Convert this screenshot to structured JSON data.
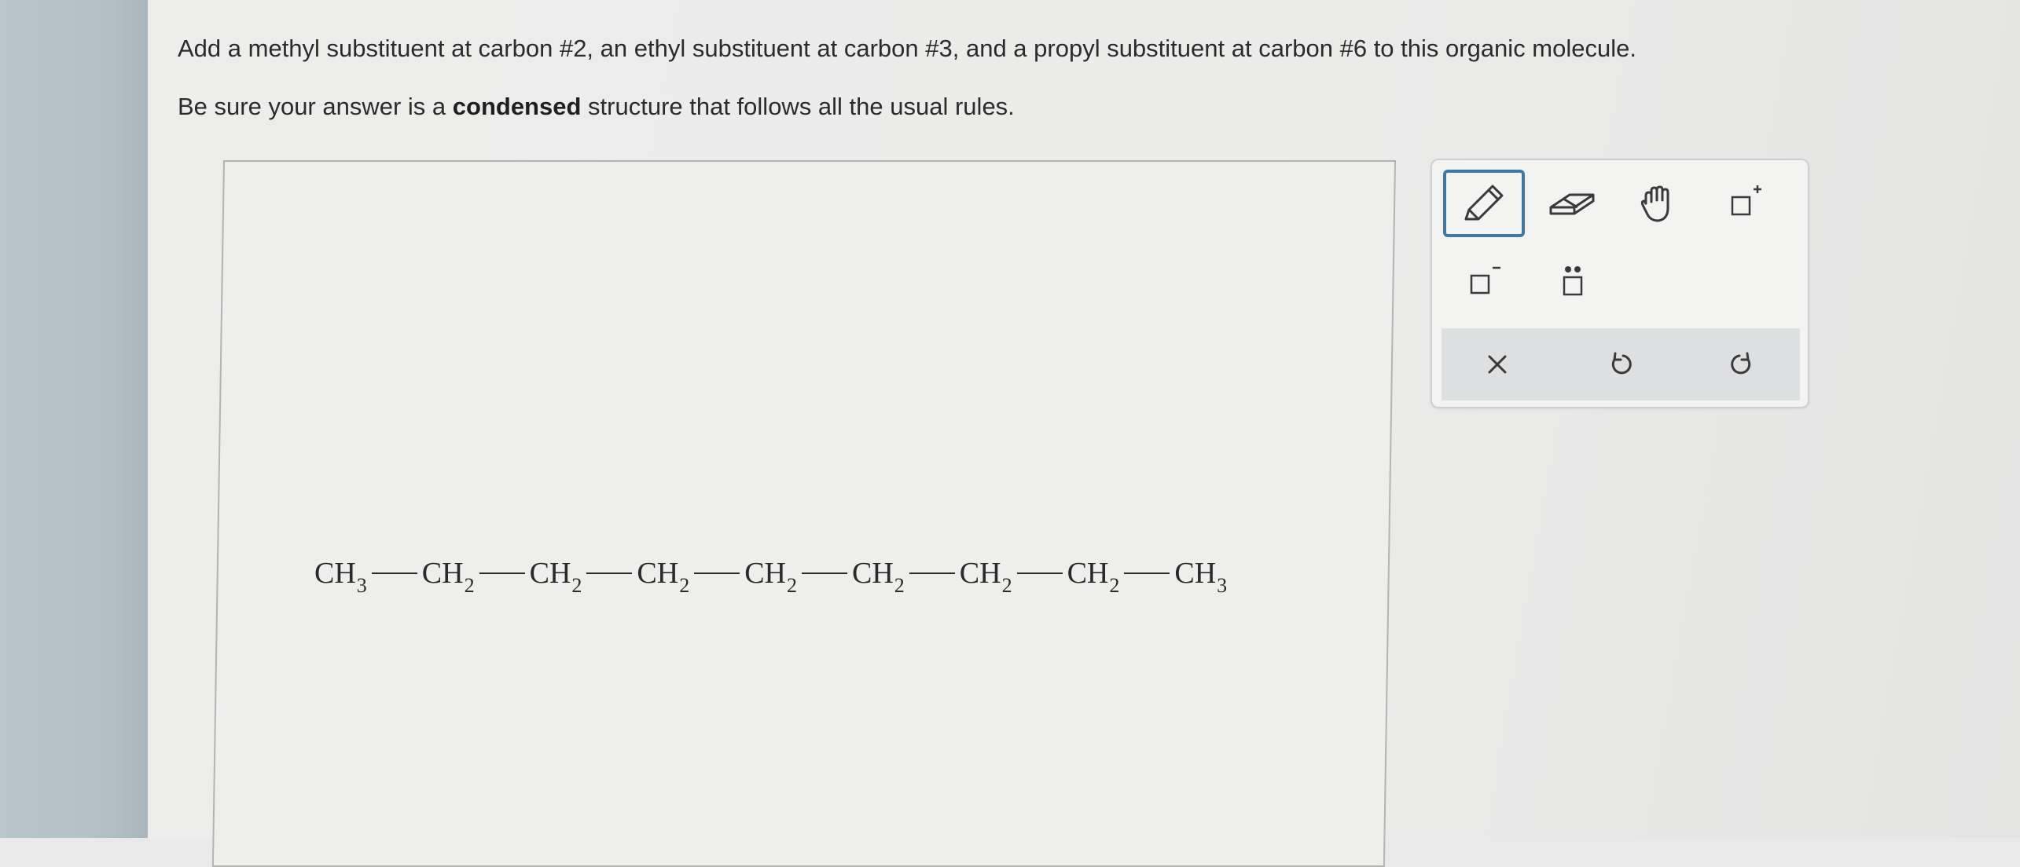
{
  "question": {
    "text": "Add a methyl substituent at carbon #2, an ethyl substituent at carbon #3, and a propyl substituent at carbon #6 to this organic molecule."
  },
  "instruction": {
    "prefix": "Be sure your answer is a ",
    "bold": "condensed",
    "suffix": " structure that follows all the usual rules."
  },
  "molecule": {
    "groups": [
      {
        "atom": "CH",
        "sub": "3"
      },
      {
        "atom": "CH",
        "sub": "2"
      },
      {
        "atom": "CH",
        "sub": "2"
      },
      {
        "atom": "CH",
        "sub": "2"
      },
      {
        "atom": "CH",
        "sub": "2"
      },
      {
        "atom": "CH",
        "sub": "2"
      },
      {
        "atom": "CH",
        "sub": "2"
      },
      {
        "atom": "CH",
        "sub": "2"
      },
      {
        "atom": "CH",
        "sub": "3"
      }
    ]
  },
  "toolbar": {
    "tools": [
      {
        "id": "pencil",
        "icon": "pencil-icon",
        "selected": true
      },
      {
        "id": "eraser",
        "icon": "eraser-icon",
        "selected": false
      },
      {
        "id": "hand",
        "icon": "hand-icon",
        "selected": false
      },
      {
        "id": "charge-plus",
        "icon": "positive-charge-icon",
        "selected": false
      },
      {
        "id": "charge-minus",
        "icon": "negative-charge-icon",
        "selected": false
      },
      {
        "id": "lone-pair",
        "icon": "lone-pair-icon",
        "selected": false
      }
    ],
    "actions": [
      {
        "id": "clear",
        "icon": "close-icon"
      },
      {
        "id": "undo",
        "icon": "undo-icon"
      },
      {
        "id": "redo",
        "icon": "redo-icon"
      }
    ],
    "accent_color": "#3e78a3"
  }
}
